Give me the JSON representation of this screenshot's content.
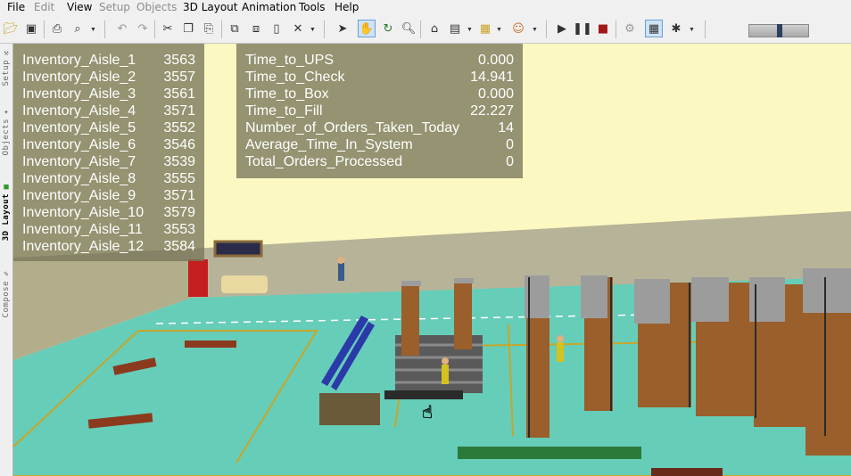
{
  "menu": {
    "file": "File",
    "edit": "Edit",
    "view": "View",
    "setup": "Setup",
    "objects": "Objects",
    "layout3d": "3D Layout",
    "animation": "Animation",
    "tools": "Tools",
    "help": "Help"
  },
  "toolbar_icons": [
    "open-folder-icon",
    "save-icon",
    "print-icon",
    "print-preview-icon",
    "undo-icon",
    "redo-icon",
    "cut-icon",
    "copy-icon",
    "paste-icon",
    "pointer-icon",
    "hand-icon",
    "rotate-icon",
    "zoom-icon",
    "home-icon",
    "camera-icon",
    "play-icon",
    "pause-icon",
    "stop-icon",
    "grid-icon",
    "speed-slider"
  ],
  "speed_slider_value": 0.5,
  "side_tabs": {
    "setup": "Setup",
    "objects": "Objects",
    "layout3d": "3D Layout",
    "compose": "Compose"
  },
  "inventory": [
    {
      "label": "Inventory_Aisle_1",
      "value": "3563"
    },
    {
      "label": "Inventory_Aisle_2",
      "value": "3557"
    },
    {
      "label": "Inventory_Aisle_3",
      "value": "3561"
    },
    {
      "label": "Inventory_Aisle_4",
      "value": "3571"
    },
    {
      "label": "Inventory_Aisle_5",
      "value": "3552"
    },
    {
      "label": "Inventory_Aisle_6",
      "value": "3546"
    },
    {
      "label": "Inventory_Aisle_7",
      "value": "3539"
    },
    {
      "label": "Inventory_Aisle_8",
      "value": "3555"
    },
    {
      "label": "Inventory_Aisle_9",
      "value": "3571"
    },
    {
      "label": "Inventory_Aisle_10",
      "value": "3579"
    },
    {
      "label": "Inventory_Aisle_11",
      "value": "3553"
    },
    {
      "label": "Inventory_Aisle_12",
      "value": "3584"
    }
  ],
  "stats": [
    {
      "label": "Time_to_UPS",
      "value": "0.000"
    },
    {
      "label": "Time_to_Check",
      "value": "14.941"
    },
    {
      "label": "Time_to_Box",
      "value": "0.000"
    },
    {
      "label": "Time_to_Fill",
      "value": "22.227"
    },
    {
      "label": "Number_of_Orders_Taken_Today",
      "value": "14"
    },
    {
      "label": "Average_Time_In_System",
      "value": "0"
    },
    {
      "label": "Total_Orders_Processed",
      "value": "0"
    }
  ],
  "colors": {
    "floor": "#66cdb8",
    "wall": "#b8b49c",
    "ceiling": "#fbf8c2",
    "panel": "#78765a",
    "shelf_box": "#9a5f2a",
    "shelf_top": "#9c9c9c"
  }
}
